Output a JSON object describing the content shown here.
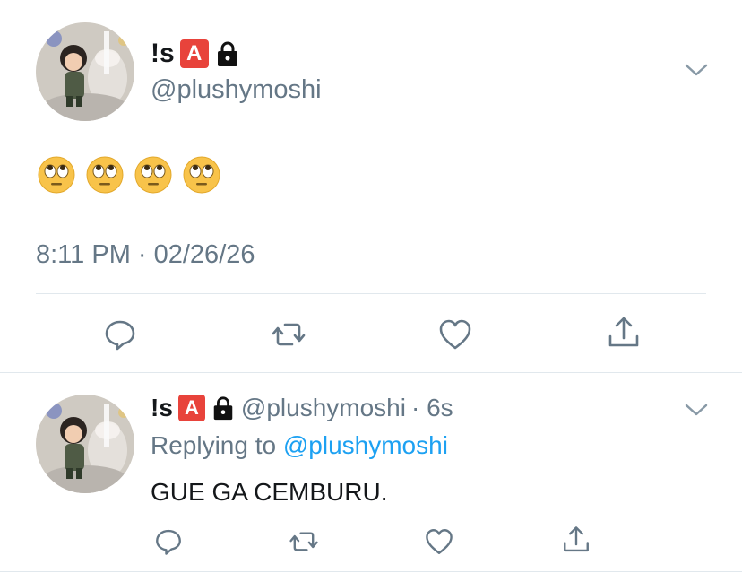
{
  "main_tweet": {
    "display_name": "!s",
    "badge_letter": "A",
    "handle": "@plushymoshi",
    "emoji_text": "🙄🙄🙄🙄",
    "timestamp": "8:11 PM · 02/26/26"
  },
  "reply_tweet": {
    "display_name": "!s",
    "badge_letter": "A",
    "handle": "@plushymoshi",
    "time_ago": "· 6s",
    "replying_prefix": "Replying to",
    "replying_handle": "@plushymoshi",
    "text": "GUE GA CEMBURU."
  },
  "colors": {
    "text": "#14171a",
    "muted": "#657786",
    "link": "#1da1f2",
    "divider": "#e1e8ed",
    "badge": "#e8433b"
  },
  "icons": [
    "chevron-down-icon",
    "reply-icon",
    "retweet-icon",
    "like-icon",
    "share-icon",
    "lock-icon",
    "eye-roll-emoji-icon"
  ]
}
